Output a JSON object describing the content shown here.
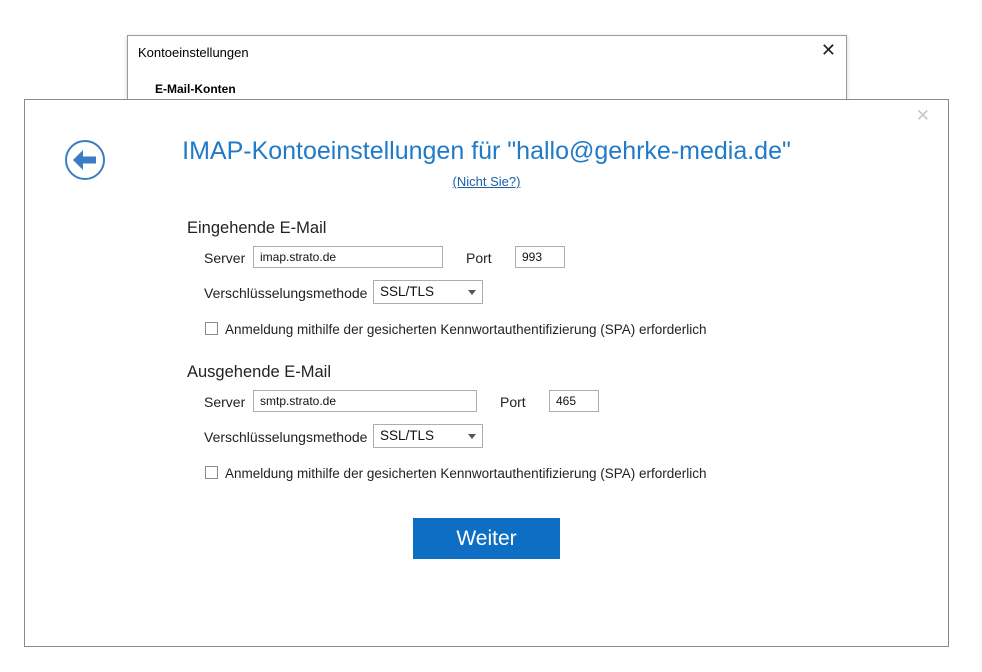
{
  "background_dialog": {
    "title": "Kontoeinstellungen",
    "close_glyph": "✕",
    "section_label": "E-Mail-Konten"
  },
  "dialog": {
    "close_glyph": "✕",
    "back_icon": "arrow-left-circle-icon",
    "title": "IMAP-Kontoeinstellungen für \"hallo@gehrke-media.de\"",
    "not_you_link": "(Nicht Sie?)"
  },
  "incoming": {
    "heading": "Eingehende E-Mail",
    "server_label": "Server",
    "server_value": "imap.strato.de",
    "port_label": "Port",
    "port_value": "993",
    "encryption_label": "Verschlüsselungsmethode",
    "encryption_value": "SSL/TLS",
    "spa_label": "Anmeldung mithilfe der gesicherten Kennwortauthentifizierung (SPA) erforderlich",
    "spa_checked": false
  },
  "outgoing": {
    "heading": "Ausgehende E-Mail",
    "server_label": "Server",
    "server_value": "smtp.strato.de",
    "port_label": "Port",
    "port_value": "465",
    "encryption_label": "Verschlüsselungsmethode",
    "encryption_value": "SSL/TLS",
    "spa_label": "Anmeldung mithilfe der gesicherten Kennwortauthentifizierung (SPA) erforderlich",
    "spa_checked": false
  },
  "actions": {
    "next_label": "Weiter"
  },
  "colors": {
    "accent": "#1f7ac8",
    "button": "#0e6ec4",
    "link": "#1a5fa8"
  }
}
